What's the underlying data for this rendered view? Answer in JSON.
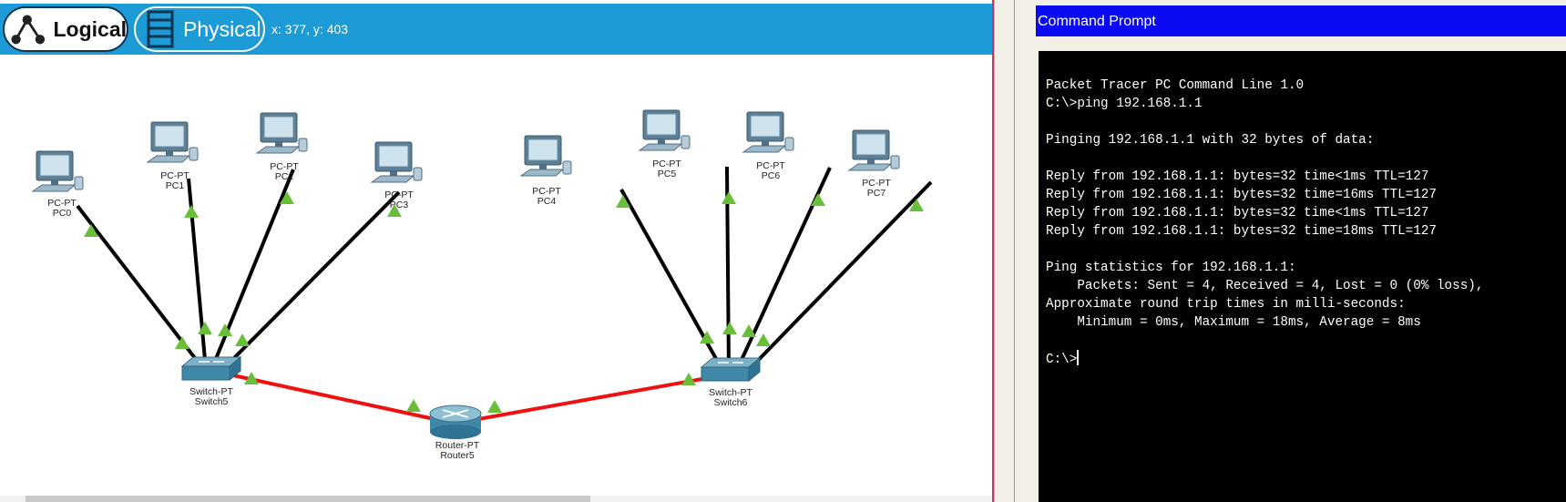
{
  "toolbar": {
    "logical_label": "Logical",
    "physical_label": "Physical",
    "coordinates": "x: 377, y: 403",
    "accent_color": "#1d9bd6"
  },
  "topology": {
    "devices": [
      {
        "id": "PC0",
        "type": "PC-PT",
        "icon": "pc-icon"
      },
      {
        "id": "PC1",
        "type": "PC-PT",
        "icon": "pc-icon"
      },
      {
        "id": "PC2",
        "type": "PC-PT",
        "icon": "pc-icon"
      },
      {
        "id": "PC3",
        "type": "PC-PT",
        "icon": "pc-icon"
      },
      {
        "id": "PC4",
        "type": "PC-PT",
        "icon": "pc-icon"
      },
      {
        "id": "PC5",
        "type": "PC-PT",
        "icon": "pc-icon"
      },
      {
        "id": "PC6",
        "type": "PC-PT",
        "icon": "pc-icon"
      },
      {
        "id": "PC7",
        "type": "PC-PT",
        "icon": "pc-icon"
      },
      {
        "id": "Switch5",
        "type": "Switch-PT",
        "icon": "switch-icon"
      },
      {
        "id": "Switch6",
        "type": "Switch-PT",
        "icon": "switch-icon"
      },
      {
        "id": "Router5",
        "type": "Router-PT",
        "icon": "router-icon"
      }
    ],
    "links": [
      {
        "from": "PC0",
        "to": "Switch5",
        "cable": "copper-straight",
        "color": "#000000"
      },
      {
        "from": "PC1",
        "to": "Switch5",
        "cable": "copper-straight",
        "color": "#000000"
      },
      {
        "from": "PC2",
        "to": "Switch5",
        "cable": "copper-straight",
        "color": "#000000"
      },
      {
        "from": "PC3",
        "to": "Switch5",
        "cable": "copper-straight",
        "color": "#000000"
      },
      {
        "from": "PC4",
        "to": "Switch6",
        "cable": "copper-straight",
        "color": "#000000"
      },
      {
        "from": "PC5",
        "to": "Switch6",
        "cable": "copper-straight",
        "color": "#000000"
      },
      {
        "from": "PC6",
        "to": "Switch6",
        "cable": "copper-straight",
        "color": "#000000"
      },
      {
        "from": "PC7",
        "to": "Switch6",
        "cable": "copper-straight",
        "color": "#000000"
      },
      {
        "from": "Switch5",
        "to": "Router5",
        "cable": "copper-cross",
        "color": "#ee1111"
      },
      {
        "from": "Router5",
        "to": "Switch6",
        "cable": "copper-cross",
        "color": "#ee1111"
      }
    ],
    "link_status_color": "#6abf3a"
  },
  "command_prompt": {
    "title": "Command Prompt",
    "title_color": "#0a0af0",
    "lines": [
      "Packet Tracer PC Command Line 1.0",
      "C:\\>ping 192.168.1.1",
      "",
      "Pinging 192.168.1.1 with 32 bytes of data:",
      "",
      "Reply from 192.168.1.1: bytes=32 time<1ms TTL=127",
      "Reply from 192.168.1.1: bytes=32 time=16ms TTL=127",
      "Reply from 192.168.1.1: bytes=32 time<1ms TTL=127",
      "Reply from 192.168.1.1: bytes=32 time=18ms TTL=127",
      "",
      "Ping statistics for 192.168.1.1:",
      "    Packets: Sent = 4, Received = 4, Lost = 0 (0% loss),",
      "Approximate round trip times in milli-seconds:",
      "    Minimum = 0ms, Maximum = 18ms, Average = 8ms",
      ""
    ],
    "prompt": "C:\\>"
  }
}
